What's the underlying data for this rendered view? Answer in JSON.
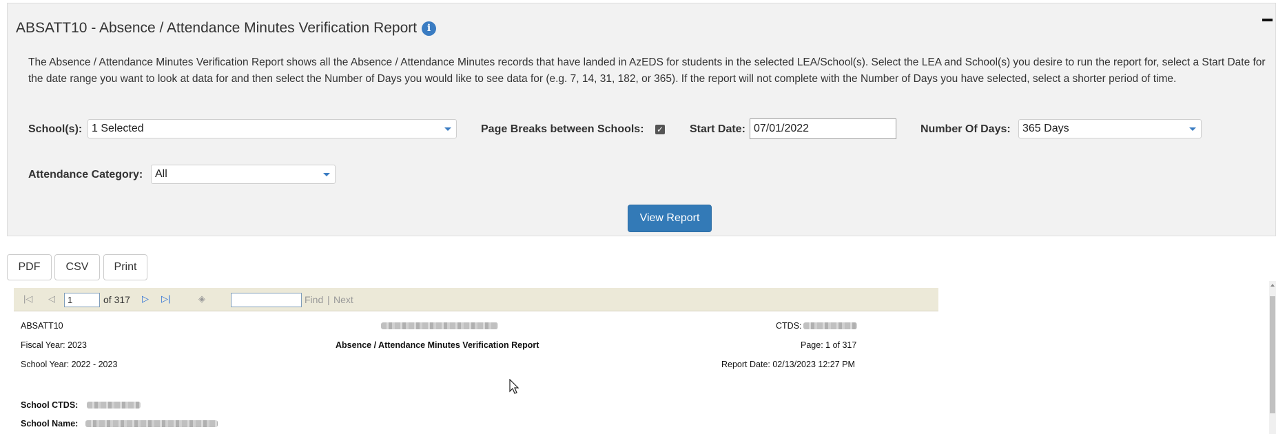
{
  "panel": {
    "title": "ABSATT10 - Absence / Attendance Minutes Verification Report",
    "info_icon": "info-circle-icon",
    "collapse_icon": "minus-icon",
    "description": "The Absence / Attendance Minutes Verification Report shows all the Absence / Attendance Minutes records that have landed in AzEDS for students in the selected LEA/School(s). Select the LEA and School(s) you desire to run the report for, select a Start Date for the date range you want to look at data for and then select the Number of Days you would like to see data for (e.g. 7, 14, 31, 182, or 365). If the report will not complete with the Number of Days you have selected, select a shorter period of time.",
    "schools_label": "School(s):",
    "schools_value": "1 Selected",
    "page_breaks_label": "Page Breaks between Schools:",
    "page_breaks_checked": true,
    "start_date_label": "Start Date:",
    "start_date_value": "07/01/2022",
    "num_days_label": "Number Of Days:",
    "num_days_value": "365 Days",
    "attendance_category_label": "Attendance Category:",
    "attendance_category_value": "All",
    "view_report_label": "View Report"
  },
  "export": {
    "pdf": "PDF",
    "csv": "CSV",
    "print": "Print"
  },
  "viewer": {
    "current_page": "1",
    "of_pages": "of 317",
    "find_label": "Find",
    "separator": "|",
    "next_label": "Next",
    "icons": [
      "first-page-icon",
      "previous-page-icon",
      "next-page-icon",
      "last-page-icon",
      "back-to-parent-icon"
    ]
  },
  "report": {
    "code": "ABSATT10",
    "fiscal_year": "Fiscal Year: 2023",
    "school_year": "School Year: 2022 - 2023",
    "title": "Absence / Attendance Minutes Verification Report",
    "ctds_label": "CTDS:",
    "page_info": "Page: 1 of 317",
    "report_date": "Report Date: 02/13/2023 12:27 PM",
    "school_ctds_label": "School CTDS:",
    "school_name_label": "School Name:"
  },
  "colors": {
    "panel_bg": "#f2f2f2",
    "primary_button": "#337ab7",
    "toolbar_bg": "#ece9d8",
    "info_icon": "#3a7cc2"
  }
}
